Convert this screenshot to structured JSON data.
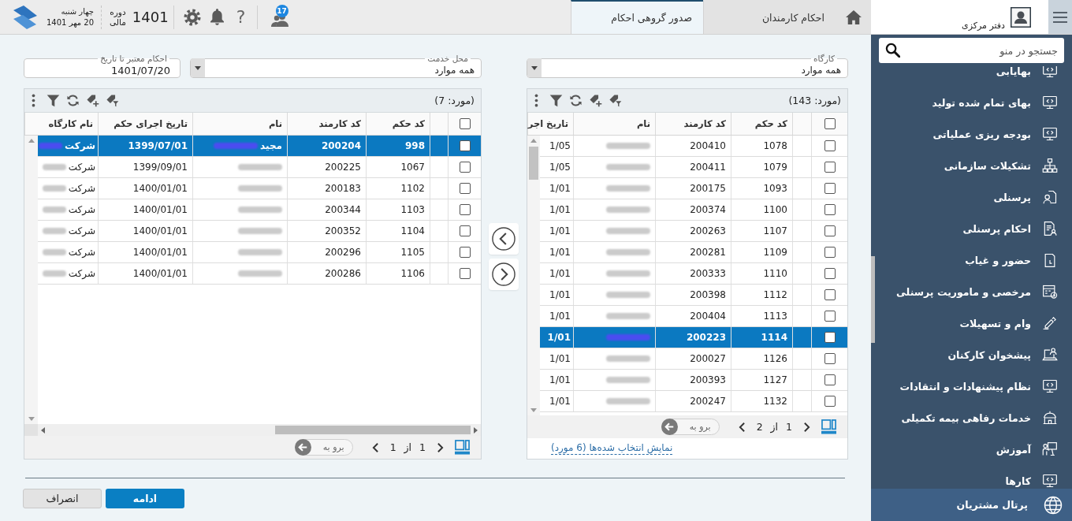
{
  "topbar": {
    "office": "دفتر مرکزی",
    "tabs": [
      {
        "label": "احکام کارمندان",
        "selected": false
      },
      {
        "label": "صدور گروهی احکام",
        "selected": true
      }
    ],
    "badge": "17",
    "help": "?",
    "fiscal_year": "1401",
    "fiscal_label": "دوره مالی",
    "weekday": "چهار شنبه",
    "date": "20 مهر 1401"
  },
  "sidebar": {
    "search": {
      "placeholder": "جستجو در منو"
    },
    "items": [
      {
        "label": "بهایابی",
        "kind": "monitor"
      },
      {
        "label": "بهای تمام شده تولید",
        "kind": "monitor"
      },
      {
        "label": "بودجه ریزی عملیاتی",
        "kind": "monitor"
      },
      {
        "label": "تشکیلات سازمانی",
        "kind": "orgchart"
      },
      {
        "label": "پرسنلی",
        "kind": "personcard"
      },
      {
        "label": "احکام پرسنلی",
        "kind": "docperson"
      },
      {
        "label": "حضور و غیاب",
        "kind": "door"
      },
      {
        "label": "مرخصی و ماموریت پرسنلی",
        "kind": "calendar"
      },
      {
        "label": "وام و تسهیلات",
        "kind": "pen"
      },
      {
        "label": "پیشخوان کارکنان",
        "kind": "laptop"
      },
      {
        "label": "نظام پیشنهادات و انتقادات",
        "kind": "monitor"
      },
      {
        "label": "خدمات رفاهی بیمه تکمیلی",
        "kind": "dome"
      },
      {
        "label": "آموزش",
        "kind": "teacher"
      },
      {
        "label": "کارها",
        "kind": "monitor"
      }
    ],
    "footer": {
      "label": "پرتال مشتریان"
    }
  },
  "source": {
    "filter": {
      "label": "کارگاه",
      "value": "همه موارد"
    },
    "count": "(مورد: 143)",
    "header_checked": false,
    "columns": [
      "کد حکم",
      "کد کارمند",
      "نام",
      "تاریخ اجر"
    ],
    "rows": [
      {
        "checked": false,
        "selected": false,
        "code": "1078",
        "employee_code": "200410",
        "name_redacted": true,
        "date": "1/05"
      },
      {
        "checked": false,
        "selected": false,
        "code": "1079",
        "employee_code": "200411",
        "name_redacted": true,
        "date": "1/05"
      },
      {
        "checked": false,
        "selected": false,
        "code": "1093",
        "employee_code": "200175",
        "name_redacted": true,
        "date": "1/01"
      },
      {
        "checked": false,
        "selected": false,
        "code": "1100",
        "employee_code": "200374",
        "name_redacted": true,
        "date": "1/01"
      },
      {
        "checked": false,
        "selected": false,
        "code": "1107",
        "employee_code": "200263",
        "name_redacted": true,
        "date": "1/01"
      },
      {
        "checked": false,
        "selected": false,
        "code": "1109",
        "employee_code": "200281",
        "name_redacted": true,
        "date": "1/01"
      },
      {
        "checked": false,
        "selected": false,
        "code": "1110",
        "employee_code": "200333",
        "name_redacted": true,
        "date": "1/01"
      },
      {
        "checked": false,
        "selected": false,
        "code": "1112",
        "employee_code": "200398",
        "name_redacted": true,
        "date": "1/01"
      },
      {
        "checked": false,
        "selected": false,
        "code": "1113",
        "employee_code": "200404",
        "name_redacted": true,
        "date": "1/01"
      },
      {
        "checked": false,
        "selected": true,
        "code": "1114",
        "employee_code": "200223",
        "name_redacted": true,
        "date": "1/01"
      },
      {
        "checked": false,
        "selected": false,
        "code": "1126",
        "employee_code": "200027",
        "name_redacted": true,
        "date": "1/01"
      },
      {
        "checked": false,
        "selected": false,
        "code": "1127",
        "employee_code": "200393",
        "name_redacted": true,
        "date": "1/01"
      },
      {
        "checked": false,
        "selected": false,
        "code": "1132",
        "employee_code": "200247",
        "name_redacted": true,
        "date": "1/01"
      }
    ],
    "pager": {
      "page_info": "1 از 2",
      "goto_placeholder": "برو به"
    },
    "show_selected": "نمایش انتخاب شده‌ها (6 مورد)"
  },
  "target": {
    "filters": [
      {
        "kind": "select",
        "label": "محل خدمت",
        "value": "همه موارد"
      },
      {
        "kind": "date",
        "label": "احکام معتبر تا تاریخ",
        "value": "1401/07/20"
      }
    ],
    "count": "(مورد: 7)",
    "header_checked": false,
    "columns": [
      "کد حکم",
      "کد کارمند",
      "نام",
      "تاریخ اجرای حکم",
      "نام کارگاه"
    ],
    "rows": [
      {
        "checked": false,
        "selected": true,
        "code": "998",
        "employee_code": "200204",
        "name": "مجید",
        "name_redacted": true,
        "date": "1399/07/01",
        "workshop": "شرکت",
        "workshop_redacted": true
      },
      {
        "checked": false,
        "selected": false,
        "code": "1067",
        "employee_code": "200225",
        "name_redacted": true,
        "date": "1399/09/01",
        "workshop": "شرکت",
        "workshop_redacted": true
      },
      {
        "checked": false,
        "selected": false,
        "code": "1102",
        "employee_code": "200183",
        "name_redacted": true,
        "date": "1400/01/01",
        "workshop": "شرکت",
        "workshop_redacted": true
      },
      {
        "checked": false,
        "selected": false,
        "code": "1103",
        "employee_code": "200344",
        "name_redacted": true,
        "date": "1400/01/01",
        "workshop": "شرکت",
        "workshop_redacted": true
      },
      {
        "checked": false,
        "selected": false,
        "code": "1104",
        "employee_code": "200352",
        "name_redacted": true,
        "date": "1400/01/01",
        "workshop": "شرکت",
        "workshop_redacted": true
      },
      {
        "checked": false,
        "selected": false,
        "code": "1105",
        "employee_code": "200296",
        "name_redacted": true,
        "date": "1400/01/01",
        "workshop": "شرکت",
        "workshop_redacted": true
      },
      {
        "checked": false,
        "selected": false,
        "code": "1106",
        "employee_code": "200286",
        "name_redacted": true,
        "date": "1400/01/01",
        "workshop": "شرکت",
        "workshop_redacted": true
      }
    ],
    "pager": {
      "page_info": "1 از 1",
      "goto_placeholder": "برو به"
    }
  },
  "actions": [
    {
      "label": "ادامه",
      "kind": "primary"
    },
    {
      "label": "انصراف",
      "kind": "secondary"
    }
  ]
}
